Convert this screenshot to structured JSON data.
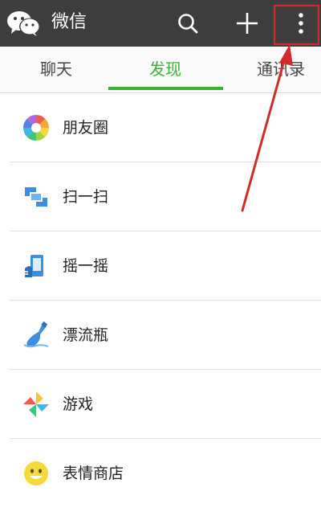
{
  "header": {
    "title": "微信",
    "logo_icon": "wechat-logo-icon",
    "search_icon": "search-icon",
    "add_icon": "plus-icon",
    "more_icon": "more-vertical-icon",
    "background_color": "#3d3d3d"
  },
  "tabs": [
    {
      "label": "聊天",
      "active": false
    },
    {
      "label": "发现",
      "active": true
    },
    {
      "label": "通讯录",
      "active": false
    }
  ],
  "accent_color": "#3cb034",
  "discover_items": [
    {
      "label": "朋友圈",
      "icon": "moments-icon"
    },
    {
      "label": "扫一扫",
      "icon": "scan-icon"
    },
    {
      "label": "摇一摇",
      "icon": "shake-icon"
    },
    {
      "label": "漂流瓶",
      "icon": "drift-bottle-icon"
    },
    {
      "label": "游戏",
      "icon": "games-icon"
    },
    {
      "label": "表情商店",
      "icon": "sticker-store-icon"
    }
  ],
  "annotation": {
    "color": "#d22a2a",
    "target": "more-button"
  }
}
